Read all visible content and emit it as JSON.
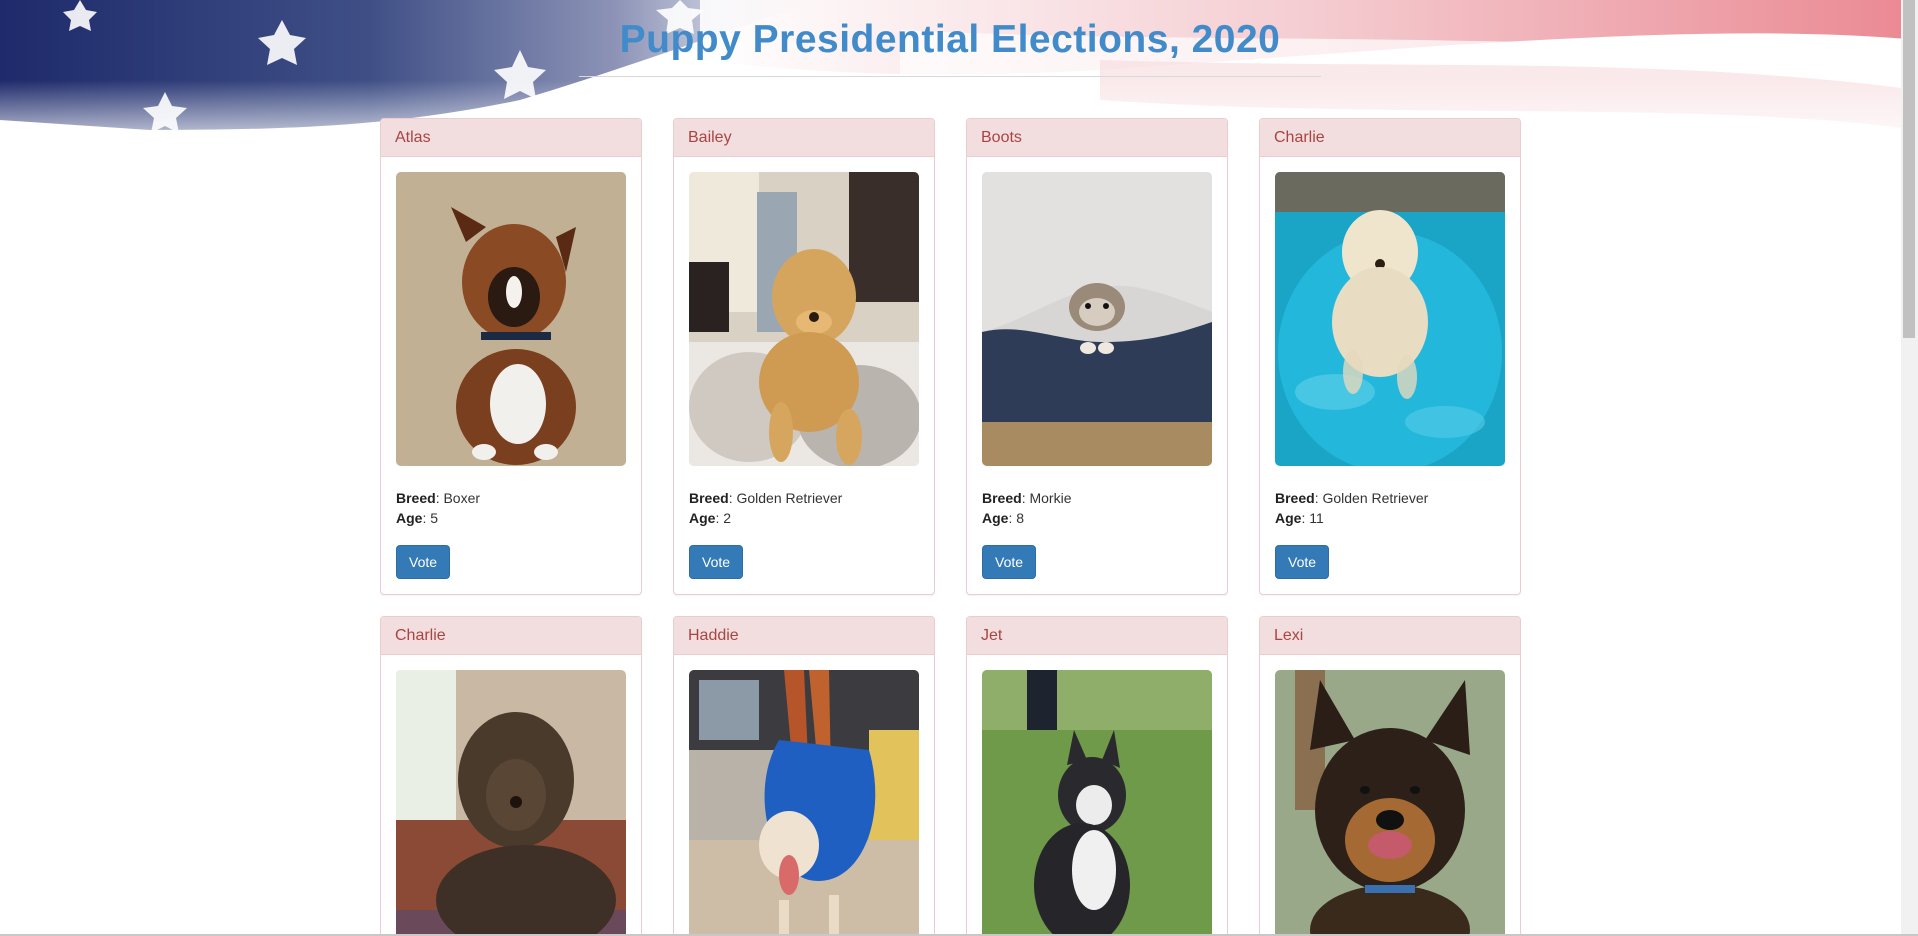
{
  "page": {
    "title": "Puppy Presidential Elections, 2020"
  },
  "labels": {
    "breed": "Breed",
    "age": "Age",
    "vote": "Vote"
  },
  "colors": {
    "title": "#428bca",
    "panel_heading_bg": "#f2dede",
    "panel_heading_text": "#a94442",
    "panel_border": "#ebccd1",
    "vote_button": "#337ab7"
  },
  "pets": [
    {
      "name": "Atlas",
      "breed": "Boxer",
      "age": "5",
      "photo": "boxer-dog-photo"
    },
    {
      "name": "Bailey",
      "breed": "Golden Retriever",
      "age": "2",
      "photo": "golden-retriever-photo"
    },
    {
      "name": "Boots",
      "breed": "Morkie",
      "age": "8",
      "photo": "morkie-photo"
    },
    {
      "name": "Charlie",
      "breed": "Golden Retriever",
      "age": "11",
      "photo": "golden-retriever-pool-photo"
    },
    {
      "name": "Charlie",
      "photo": "doodle-dog-photo"
    },
    {
      "name": "Haddie",
      "photo": "dog-in-bag-photo"
    },
    {
      "name": "Jet",
      "photo": "husky-photo"
    },
    {
      "name": "Lexi",
      "photo": "german-shepherd-photo"
    }
  ]
}
